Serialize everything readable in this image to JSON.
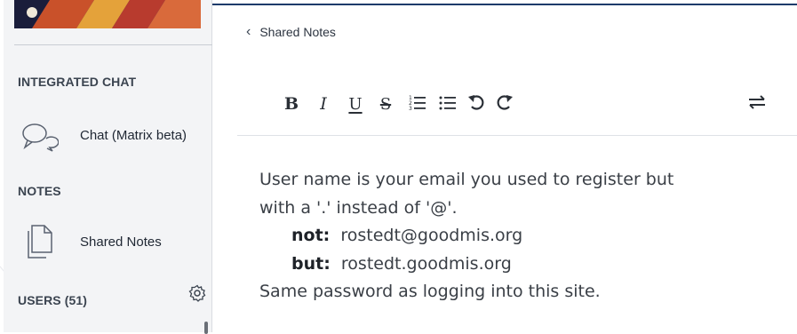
{
  "sidebar": {
    "integrated_chat_heading": "INTEGRATED CHAT",
    "chat_item_label": "Chat (Matrix beta)",
    "notes_heading": "NOTES",
    "shared_notes_item_label": "Shared Notes",
    "users_heading": "USERS (51)"
  },
  "notes_panel": {
    "back_label": "Shared Notes",
    "toolbar": {
      "bold": "B",
      "italic": "I",
      "underline": "U",
      "strikethrough": "S"
    },
    "content": {
      "line1": "User name is your email you used to register but",
      "line2": "with a '.' instead of '@'.",
      "not_label": "not:",
      "not_value": "rostedt@goodmis.org",
      "but_label": "but:",
      "but_value": "rostedt.goodmis.org",
      "line5": "Same password as logging into this site."
    }
  },
  "colors": {
    "sidebar_bg": "#f3f4f6",
    "topbar_accent": "#1d3b6b",
    "text_dark": "#1f2733"
  },
  "icons": [
    "chat-bubbles-icon",
    "document-icon",
    "gear-icon",
    "chevron-left-icon",
    "ordered-list-icon",
    "bullet-list-icon",
    "undo-icon",
    "redo-icon",
    "swap-arrows-icon"
  ]
}
